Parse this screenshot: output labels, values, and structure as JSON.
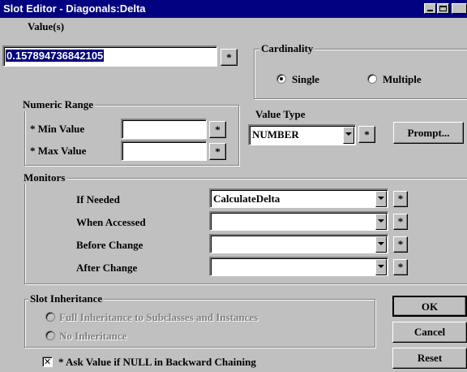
{
  "window": {
    "title": "Slot Editor - Diagonals:Delta"
  },
  "values": {
    "label": "Value(s)",
    "value": "0.157894736842105",
    "star": "*"
  },
  "cardinality": {
    "title": "Cardinality",
    "single": "Single",
    "multiple": "Multiple",
    "selected": "Single"
  },
  "numeric_range": {
    "title": "Numeric Range",
    "min_label": "* Min Value",
    "max_label": "* Max Value",
    "min_value": "",
    "max_value": "",
    "star": "*"
  },
  "value_type": {
    "label": "Value Type",
    "selected": "NUMBER",
    "star": "*",
    "prompt_button": "Prompt..."
  },
  "monitors": {
    "title": "Monitors",
    "rows": [
      {
        "label": "If Needed",
        "value": "CalculateDelta",
        "star": "*"
      },
      {
        "label": "When Accessed",
        "value": "",
        "star": "*"
      },
      {
        "label": "Before Change",
        "value": "",
        "star": "*"
      },
      {
        "label": "After Change",
        "value": "",
        "star": "*"
      }
    ]
  },
  "inheritance": {
    "title": "Slot Inheritance",
    "full": "Full Inheritance to Subclasses and Instances",
    "none": "No Inheritance",
    "ask_value_label": "* Ask Value if NULL in Backward Chaining",
    "ask_value_checked": true,
    "check_mark": "✕"
  },
  "buttons": {
    "ok": "OK",
    "cancel": "Cancel",
    "reset": "Reset"
  }
}
